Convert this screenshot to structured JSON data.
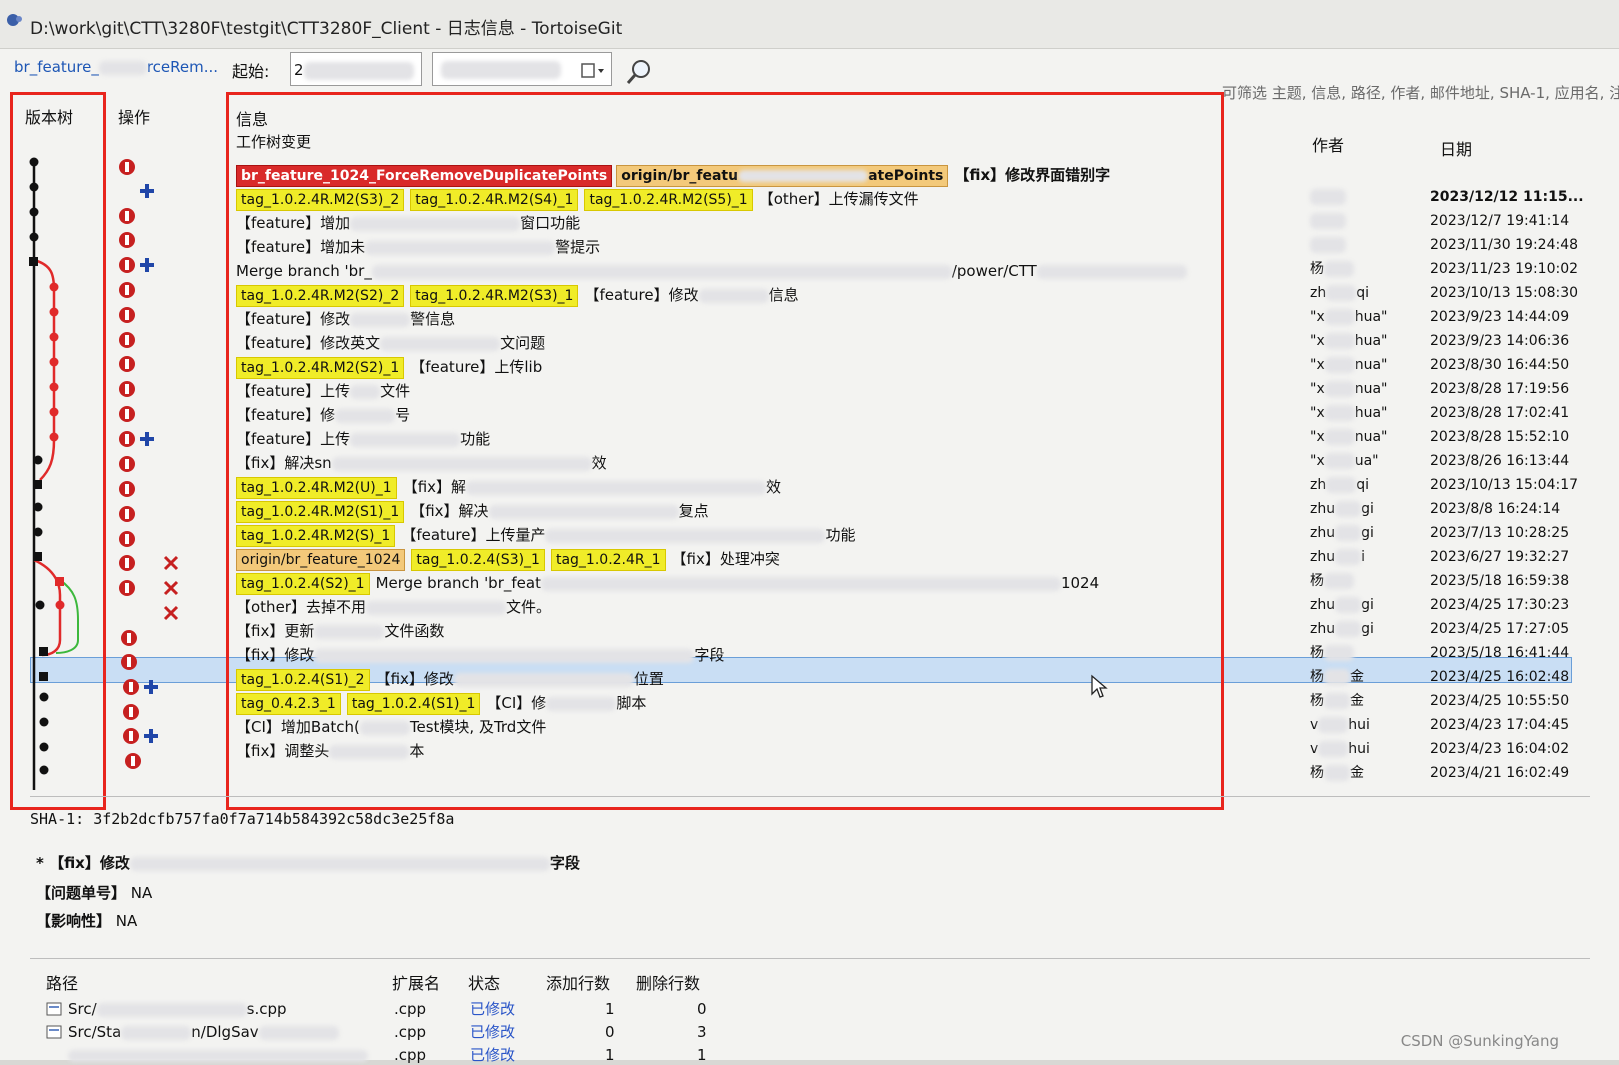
{
  "window": {
    "title": "D:\\work\\git\\CTT\\3280F\\testgit\\CTT3280F_Client - 日志信息 - TortoiseGit"
  },
  "toolbar": {
    "branch": "br_feature_",
    "branch_suffix": "rceRem...",
    "from_label": "起始:",
    "from_value": "2",
    "filter_hint": "可筛选 主题, 信息, 路径, 作者, 邮件地址, SHA-1, 应用名, 注"
  },
  "columns": {
    "graph": "版本树",
    "actions": "操作",
    "message": "信息",
    "author": "作者",
    "date": "日期"
  },
  "log": {
    "working_tree": "工作树变更",
    "rows": [
      {
        "refs_red": "br_feature_1024_ForceRemoveDuplicatePoints",
        "refs_orange": "origin/br_featu",
        "refs_orange_tail": "atePoints",
        "msg": "【fix】修改界面错别字",
        "author": "",
        "date": "2023/12/12 11:15...",
        "bold": true
      },
      {
        "tags": [
          "tag_1.0.2.4R.M2(S3)_2",
          "tag_1.0.2.4R.M2(S4)_1",
          "tag_1.0.2.4R.M2(S5)_1"
        ],
        "msg": "【other】上传漏传文件",
        "author": "",
        "date": "2023/12/7 19:41:14"
      },
      {
        "msg": "【feature】增加",
        "msg_tail": "窗口功能",
        "author": "",
        "date": "2023/11/30 19:24:48"
      },
      {
        "msg": "【feature】增加未",
        "msg_tail": "警提示",
        "author": "杨",
        "date": "2023/11/23 19:10:02"
      },
      {
        "msg": "Merge branch 'br_",
        "msg_tail": "/power/CTT",
        "author": "zh",
        "author_tail": "qi",
        "date": "2023/10/13 15:08:30"
      },
      {
        "tags": [
          "tag_1.0.2.4R.M2(S2)_2",
          "tag_1.0.2.4R.M2(S3)_1"
        ],
        "msg": "【feature】修改",
        "msg_tail": "信息",
        "author": "\"x",
        "author_tail": "hua\"",
        "date": "2023/9/23 14:44:09"
      },
      {
        "msg": "【feature】修改",
        "msg_tail": "警信息",
        "author": "\"x",
        "author_tail": "hua\"",
        "date": "2023/9/23 14:06:36"
      },
      {
        "msg": "【feature】修改英文",
        "msg_tail": "文问题",
        "author": "\"x",
        "author_tail": "nua\"",
        "date": "2023/8/30 16:44:50"
      },
      {
        "tags": [
          "tag_1.0.2.4R.M2(S2)_1"
        ],
        "msg": "【feature】上传lib",
        "author": "\"x",
        "author_tail": "nua\"",
        "date": "2023/8/28 17:19:56"
      },
      {
        "msg": "【feature】上传",
        "msg_tail": "文件",
        "author": "\"x",
        "author_tail": "hua\"",
        "date": "2023/8/28 17:02:41"
      },
      {
        "msg": "【feature】修",
        "msg_tail": "号",
        "author": "\"x",
        "author_tail": "nua\"",
        "date": "2023/8/28 15:52:10"
      },
      {
        "msg": "【feature】上传",
        "msg_tail": "功能",
        "author": "\"x",
        "author_tail": "ua\"",
        "date": "2023/8/26 16:13:44"
      },
      {
        "msg": "【fix】解决sn",
        "msg_tail": "效",
        "author": "zh",
        "author_tail": "qi",
        "date": "2023/10/13 15:04:17"
      },
      {
        "tags": [
          "tag_1.0.2.4R.M2(U)_1"
        ],
        "msg": "【fix】解",
        "msg_tail": "效",
        "author": "zhu",
        "author_tail": "gi",
        "date": "2023/8/8 16:24:14"
      },
      {
        "tags": [
          "tag_1.0.2.4R.M2(S1)_1"
        ],
        "msg": "【fix】解决",
        "msg_tail": "复点",
        "author": "zhu",
        "author_tail": "gi",
        "date": "2023/7/13 10:28:25"
      },
      {
        "tags": [
          "tag_1.0.2.4R.M2(S)_1"
        ],
        "msg": "【feature】上传量产",
        "msg_tail": "功能",
        "author": "zhu",
        "author_tail": "i",
        "date": "2023/6/27 19:32:27"
      },
      {
        "tags_orange": [
          "origin/br_feature_1024"
        ],
        "tags": [
          "tag_1.0.2.4(S3)_1",
          "tag_1.0.2.4R_1"
        ],
        "msg": "【fix】处理冲突",
        "author": "杨",
        "date": "2023/5/18 16:59:38"
      },
      {
        "tags": [
          "tag_1.0.2.4(S2)_1"
        ],
        "msg": "Merge branch 'br_feat",
        "msg_tail": "1024",
        "author": "zhu",
        "author_tail": "gi",
        "date": "2023/4/25 17:30:23"
      },
      {
        "msg": "【other】去掉不用",
        "msg_tail": "文件。",
        "author": "zhu",
        "author_tail": "gi",
        "date": "2023/4/25 17:27:05"
      },
      {
        "msg": "【fix】更新",
        "msg_tail": "文件函数",
        "author": "杨",
        "date": "2023/5/18 16:41:44"
      },
      {
        "msg": "【fix】修改",
        "msg_tail": "字段",
        "author": "杨",
        "author_tail": "金",
        "date": "2023/4/25 16:02:48",
        "selected": true
      },
      {
        "tags": [
          "tag_1.0.2.4(S1)_2"
        ],
        "msg": "【fix】修改",
        "msg_tail": "位置",
        "author": "杨",
        "author_tail": "金",
        "date": "2023/4/25 10:55:50"
      },
      {
        "tags": [
          "tag_0.4.2.3_1",
          "tag_1.0.2.4(S1)_1"
        ],
        "msg": "【CI】修",
        "msg_tail": "脚本",
        "author": "v",
        "author_tail": "hui",
        "date": "2023/4/23 17:04:45"
      },
      {
        "msg": "【CI】增加Batch(",
        "msg_tail": "Test模块, 及Trd文件",
        "author": "v",
        "author_tail": "hui",
        "date": "2023/4/23 16:04:02"
      },
      {
        "msg": "【fix】调整头",
        "msg_tail": "本",
        "author": "杨",
        "author_tail": "金",
        "date": "2023/4/21 16:02:49"
      }
    ]
  },
  "detail": {
    "sha_label": "SHA-1:",
    "sha": "3f2b2dcfb757fa0f7a714b584392c58dc3e25f8a",
    "subject_prefix": "* 【fix】修改",
    "subject_tail": "字段",
    "issue_label": "【问题单号】",
    "issue_value": "NA",
    "impact_label": "【影响性】",
    "impact_value": "NA"
  },
  "files": {
    "headers": [
      "路径",
      "扩展名",
      "状态",
      "添加行数",
      "删除行数"
    ],
    "rows": [
      {
        "path": "Src/",
        "path_tail": "s.cpp",
        "ext": ".cpp",
        "status": "已修改",
        "added": "1",
        "deleted": "0"
      },
      {
        "path": "Src/Sta",
        "path_tail": "n/DlgSav",
        "ext": ".cpp",
        "status": "已修改",
        "added": "0",
        "deleted": "3"
      },
      {
        "path": "",
        "path_tail": "",
        "ext": ".cpp",
        "status": "已修改",
        "added": "1",
        "deleted": "1"
      }
    ]
  },
  "watermark": "CSDN @SunkingYang",
  "colors": {
    "tag_yellow": "#f0ec28",
    "branch_red": "#d92a2a",
    "origin_orange": "#f3c97a",
    "selection": "#c9def4",
    "highlight_box": "#e8251d",
    "graph_red": "#e02a2a",
    "graph_green": "#3cb83c"
  }
}
